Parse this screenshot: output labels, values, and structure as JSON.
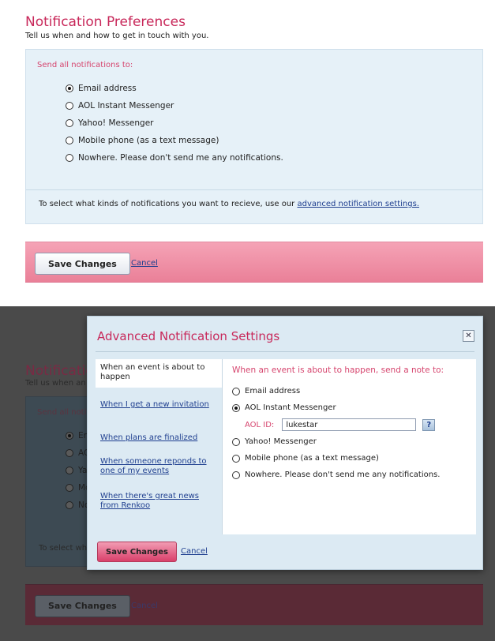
{
  "prefs": {
    "title": "Notification Preferences",
    "subtitle": "Tell us when and how to get in touch with you.",
    "send_label": "Send all notifications to:",
    "options": [
      {
        "label": "Email address",
        "selected": true
      },
      {
        "label": "AOL Instant Messenger",
        "selected": false
      },
      {
        "label": "Yahoo! Messenger",
        "selected": false
      },
      {
        "label": "Mobile phone (as a text message)",
        "selected": false
      },
      {
        "label": "Nowhere. Please don't send me any notifications.",
        "selected": false
      }
    ],
    "footnote_prefix": "To select what kinds of notifications you want to recieve, use our",
    "footnote_link": "advanced notification settings.",
    "save_label": "Save Changes",
    "cancel_label": "Cancel"
  },
  "background": {
    "title": "Notificatio",
    "subtitle": "Tell us when an",
    "send_label": "Send all noti",
    "options": [
      "En",
      "AC",
      "Ya",
      "Mc",
      "Nc"
    ],
    "footnote": "To select wh",
    "save_label": "Save Changes",
    "cancel_label": "Cancel"
  },
  "modal": {
    "title": "Advanced Notification Settings",
    "close_glyph": "✕",
    "nav": [
      {
        "label": "When an event is about to happen",
        "active": true
      },
      {
        "label": "When I get a new invitation",
        "active": false
      },
      {
        "label": "When plans are finalized",
        "active": false
      },
      {
        "label": "When someone reponds to one of my events",
        "active": false
      },
      {
        "label": "When there's great news from Renkoo",
        "active": false
      }
    ],
    "heading": "When an event is about to happen, send a note to:",
    "options": [
      {
        "label": "Email address",
        "selected": false
      },
      {
        "label": "AOL Instant Messenger",
        "selected": true
      },
      {
        "label": "Yahoo! Messenger",
        "selected": false
      },
      {
        "label": "Mobile phone (as a text message)",
        "selected": false
      },
      {
        "label": "Nowhere. Please don't send me any notifications.",
        "selected": false
      }
    ],
    "aol_id_label": "AOL ID:",
    "aol_id_value": "lukestar",
    "help_label": "?",
    "save_label": "Save Changes",
    "cancel_label": "Cancel"
  },
  "colors": {
    "accent_pink": "#c8285a",
    "panel_blue": "#e6f1f8",
    "action_bar_pink": "#ea8098",
    "link_blue": "#1f3f8f"
  },
  "icons": {
    "radio_selected": "radio-selected-icon",
    "radio_unselected": "radio-unselected-icon",
    "close": "close-icon",
    "help": "help-icon"
  }
}
